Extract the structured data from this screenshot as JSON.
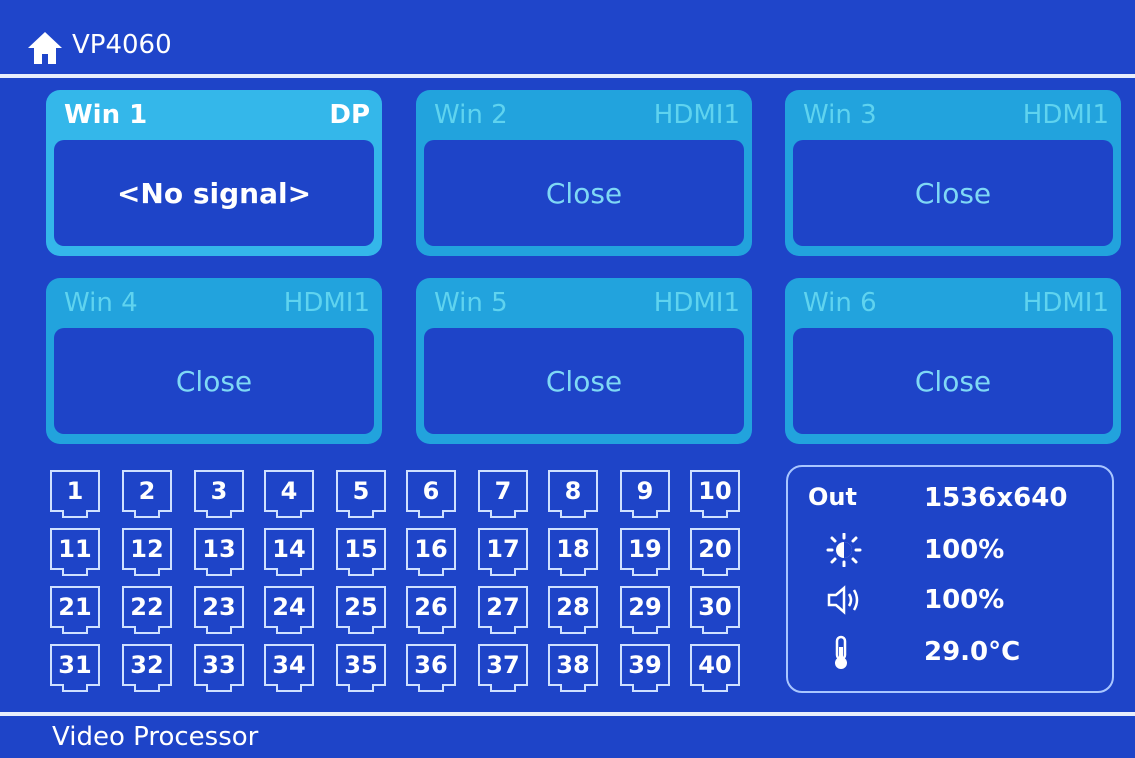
{
  "header": {
    "title": "VP4060",
    "home_icon": "home-icon"
  },
  "windows": [
    {
      "name": "Win 1",
      "source": "DP",
      "status": "<No signal>",
      "active": true
    },
    {
      "name": "Win 2",
      "source": "HDMI1",
      "status": "Close",
      "active": false
    },
    {
      "name": "Win 3",
      "source": "HDMI1",
      "status": "Close",
      "active": false
    },
    {
      "name": "Win 4",
      "source": "HDMI1",
      "status": "Close",
      "active": false
    },
    {
      "name": "Win 5",
      "source": "HDMI1",
      "status": "Close",
      "active": false
    },
    {
      "name": "Win 6",
      "source": "HDMI1",
      "status": "Close",
      "active": false
    }
  ],
  "presets": [
    "1",
    "2",
    "3",
    "4",
    "5",
    "6",
    "7",
    "8",
    "9",
    "10",
    "11",
    "12",
    "13",
    "14",
    "15",
    "16",
    "17",
    "18",
    "19",
    "20",
    "21",
    "22",
    "23",
    "24",
    "25",
    "26",
    "27",
    "28",
    "29",
    "30",
    "31",
    "32",
    "33",
    "34",
    "35",
    "36",
    "37",
    "38",
    "39",
    "40"
  ],
  "status": {
    "out_label": "Out",
    "out_value": "1536x640",
    "brightness_icon": "brightness-icon",
    "brightness_value": "100%",
    "volume_icon": "volume-icon",
    "volume_value": "100%",
    "temperature_icon": "thermometer-icon",
    "temperature_value": "29.0°C"
  },
  "footer": {
    "label": "Video Processor"
  },
  "colors": {
    "background": "#1e44c8",
    "window_tile": "#22a3dd",
    "window_tile_active": "#34b7ea",
    "text": "#ffffff"
  }
}
